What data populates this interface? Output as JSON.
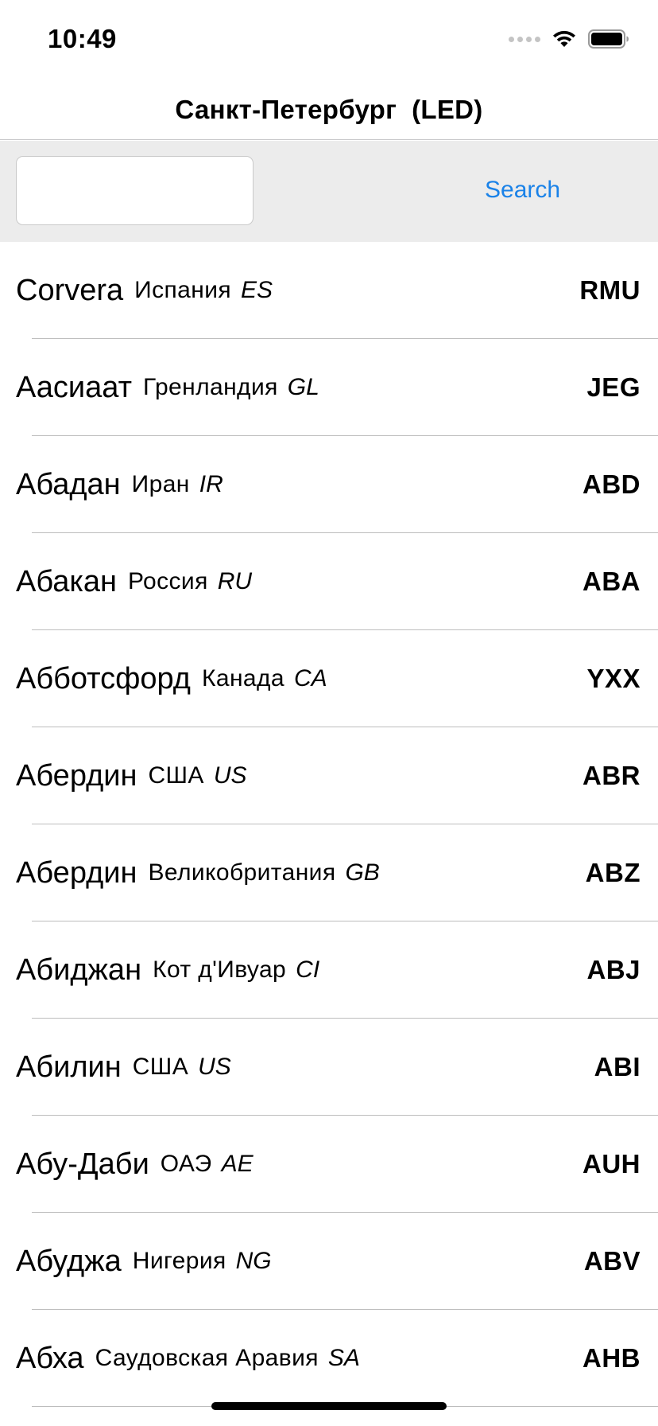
{
  "status_bar": {
    "time": "10:49"
  },
  "nav": {
    "title": "Санкт-Петербург  (LED)"
  },
  "search": {
    "value": "",
    "placeholder": "",
    "button_label": "Search"
  },
  "list": {
    "rows": [
      {
        "city": "Corvera",
        "country": "Испания",
        "country_code": "ES",
        "airport_code": "RMU"
      },
      {
        "city": "Аасиаат",
        "country": "Гренландия",
        "country_code": "GL",
        "airport_code": "JEG"
      },
      {
        "city": "Абадан",
        "country": "Иран",
        "country_code": "IR",
        "airport_code": "ABD"
      },
      {
        "city": "Абакан",
        "country": "Россия",
        "country_code": "RU",
        "airport_code": "ABA"
      },
      {
        "city": "Абботсфорд",
        "country": "Канада",
        "country_code": "CA",
        "airport_code": "YXX"
      },
      {
        "city": "Абердин",
        "country": "США",
        "country_code": "US",
        "airport_code": "ABR"
      },
      {
        "city": "Абердин",
        "country": "Великобритания",
        "country_code": "GB",
        "airport_code": "ABZ"
      },
      {
        "city": "Абиджан",
        "country": "Кот д'Ивуар",
        "country_code": "CI",
        "airport_code": "ABJ"
      },
      {
        "city": "Абилин",
        "country": "США",
        "country_code": "US",
        "airport_code": "ABI"
      },
      {
        "city": "Абу-Даби",
        "country": "ОАЭ",
        "country_code": "AE",
        "airport_code": "AUH"
      },
      {
        "city": "Абуджа",
        "country": "Нигерия",
        "country_code": "NG",
        "airport_code": "ABV"
      },
      {
        "city": "Абха",
        "country": "Саудовская Аравия",
        "country_code": "SA",
        "airport_code": "AHB"
      }
    ]
  },
  "colors": {
    "accent": "#1a82e8",
    "search_bar_bg": "#ececec",
    "separator": "#bdbdbd"
  }
}
